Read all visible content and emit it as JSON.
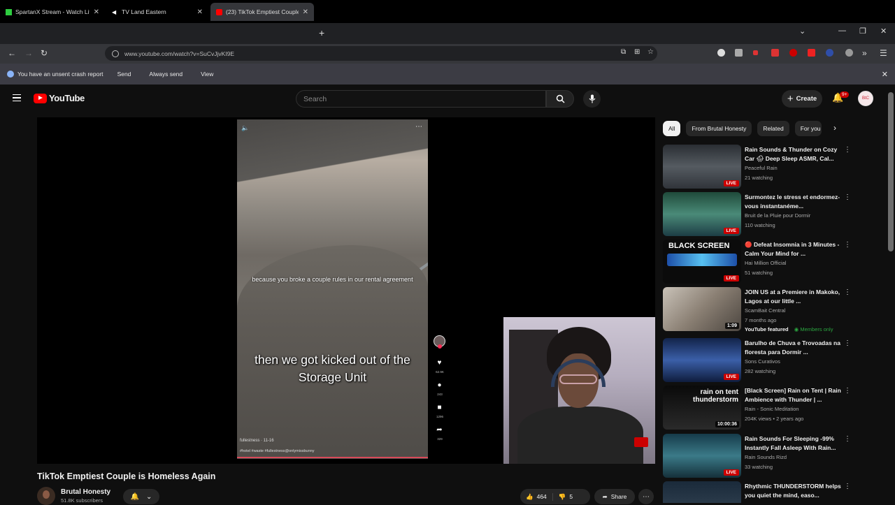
{
  "browser": {
    "tabs": [
      {
        "title": "SpartanX Stream - Watch Live o",
        "active": false
      },
      {
        "title": "TV Land Eastern",
        "active": false
      },
      {
        "title": "(23) TikTok Emptiest Couple",
        "active": true
      }
    ],
    "url": "www.youtube.com/watch?v=SuCvJjvKI9E",
    "infobar": {
      "message": "You have an unsent crash report",
      "send": "Send",
      "always_send": "Always send",
      "view": "View"
    }
  },
  "header": {
    "logo_text": "YouTube",
    "search_placeholder": "Search",
    "create_label": "Create",
    "notif_badge": "9+"
  },
  "player": {
    "caption_small": "because you broke a couple rules in our rental agreement",
    "caption_big": "then we got kicked out of the Storage Unit",
    "tt_user": "fullestness · 11-16",
    "tt_tags": "#hotel #waste #fullestness@onlymissbunny",
    "rail_counts": [
      "62.9K",
      "243",
      "1296",
      "329"
    ]
  },
  "video": {
    "title": "TikTok Emptiest Couple is Homeless Again",
    "channel": "Brutal Honesty",
    "subscribers": "51.8K subscribers",
    "likes": "464",
    "dislikes": "5",
    "share_label": "Share"
  },
  "chips": [
    "All",
    "From Brutal Honesty",
    "Related",
    "For you"
  ],
  "recommendations": [
    {
      "title": "Rain Sounds & Thunder on Cozy Car 🌧 Deep Sleep ASMR, Cal...",
      "channel": "Peaceful Rain",
      "meta": "21 watching",
      "badge": "LIVE"
    },
    {
      "title": "Surmontez le stress et endormez-vous instantanéme...",
      "channel": "Bruit de la Pluie pour Dormir",
      "meta": "110 watching",
      "badge": "LIVE"
    },
    {
      "title": "🔴 Defeat Insomnia in 3 Minutes - Calm Your Mind for ...",
      "channel": "Hai Million Official",
      "meta": "51 watching",
      "badge": "LIVE",
      "thumb_text": "BLACK SCREEN"
    },
    {
      "title": "JOIN US at a Premiere in Makoko, Lagos at our little ...",
      "channel": "ScamBait Central",
      "meta": "7 months ago",
      "badge": "1:09",
      "featured": "YouTube featured",
      "members": "Members only"
    },
    {
      "title": "Barulho de Chuva e Trovoadas na floresta para Dormir ...",
      "channel": "Sons Curativos",
      "meta": "282 watching",
      "badge": "LIVE"
    },
    {
      "title": "[Black Screen] Rain on Tent | Rain Ambience with Thunder | ...",
      "channel": "Rain - Sonic Meditation",
      "meta": "204K views • 2 years ago",
      "badge": "10:00:36",
      "thumb_text": "rain on tent thunderstorm"
    },
    {
      "title": "Rain Sounds For Sleeping -99% Instantly Fall Asleep With Rain...",
      "channel": "Rain Sounds Rizd",
      "meta": "33 watching",
      "badge": "LIVE"
    },
    {
      "title": "Rhythmic THUNDERSTORM helps you quiet the mind, easo...",
      "channel": "",
      "meta": "",
      "badge": ""
    }
  ]
}
